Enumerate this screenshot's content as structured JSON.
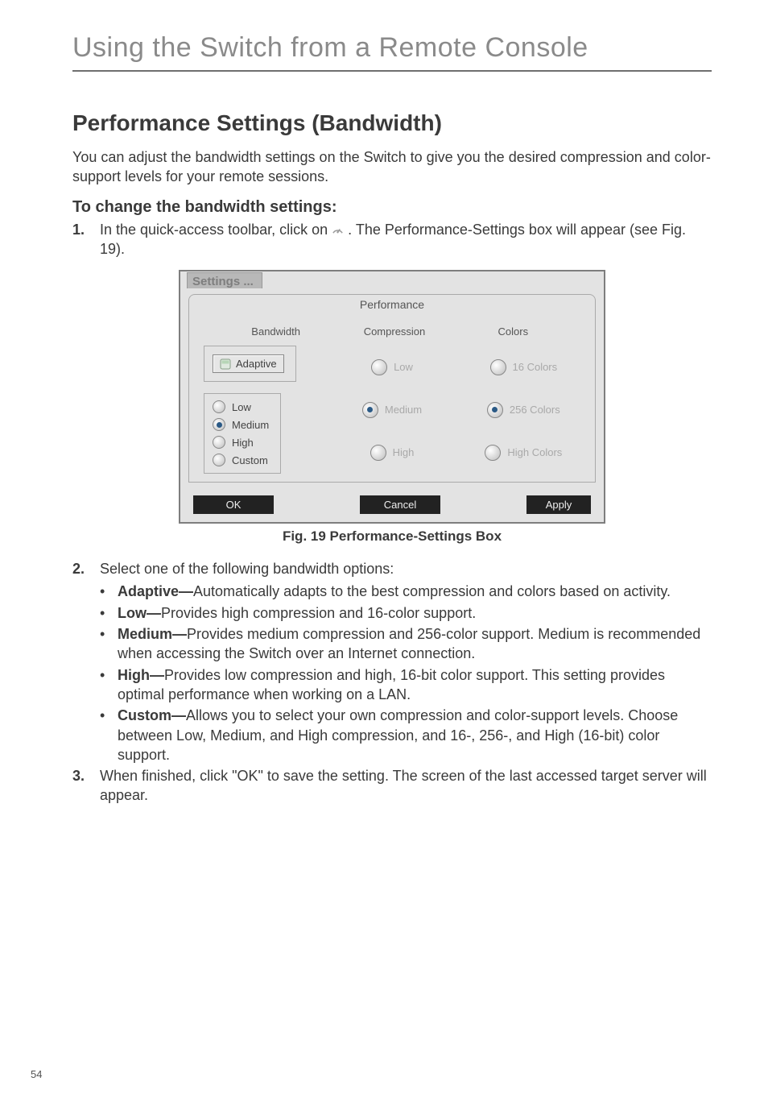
{
  "running_head": "Using the Switch from a Remote Console",
  "h2": "Performance Settings (Bandwidth)",
  "intro": "You can adjust the bandwidth settings on the Switch to give you the desired compression and color-support levels for your remote sessions.",
  "h3": "To change the bandwidth settings:",
  "step1": {
    "num": "1.",
    "part1": "In the quick-access toolbar, click on ",
    "part2": ". The Performance-Settings box will appear (see Fig. 19)."
  },
  "dialog": {
    "title": "Settings ...",
    "tab": "Performance",
    "headers": {
      "bw": "Bandwidth",
      "comp": "Compression",
      "colors": "Colors"
    },
    "adaptive": "Adaptive",
    "bandwidth": {
      "low": "Low",
      "medium": "Medium",
      "high": "High",
      "custom": "Custom"
    },
    "compression": {
      "low": "Low",
      "medium": "Medium",
      "high": "High"
    },
    "colors": {
      "c16": "16 Colors",
      "c256": "256 Colors",
      "high": "High Colors"
    },
    "ok": "OK",
    "cancel": "Cancel",
    "apply": "Apply"
  },
  "caption": "Fig. 19 Performance-Settings Box",
  "step2": {
    "num": "2.",
    "text": "Select one of the following bandwidth options:"
  },
  "bullets": {
    "adaptive": {
      "t": "Adaptive—",
      "d": "Automatically adapts to the best compression and colors based on activity."
    },
    "low": {
      "t": "Low—",
      "d": "Provides high compression and 16-color support."
    },
    "medium": {
      "t": "Medium—",
      "d": "Provides medium compression and 256-color support. Medium is recommended when accessing the Switch over an Internet connection."
    },
    "high": {
      "t": "High—",
      "d": "Provides low compression and high, 16-bit color support. This setting provides optimal performance when working on a LAN."
    },
    "custom": {
      "t": "Custom—",
      "d": "Allows you to select your own compression and color-support levels. Choose between Low, Medium, and High compression, and 16-, 256-, and High (16-bit) color support."
    }
  },
  "step3": {
    "num": "3.",
    "text": "When finished, click \"OK\" to save the setting. The screen of the last accessed target server will appear."
  },
  "page_number": "54"
}
